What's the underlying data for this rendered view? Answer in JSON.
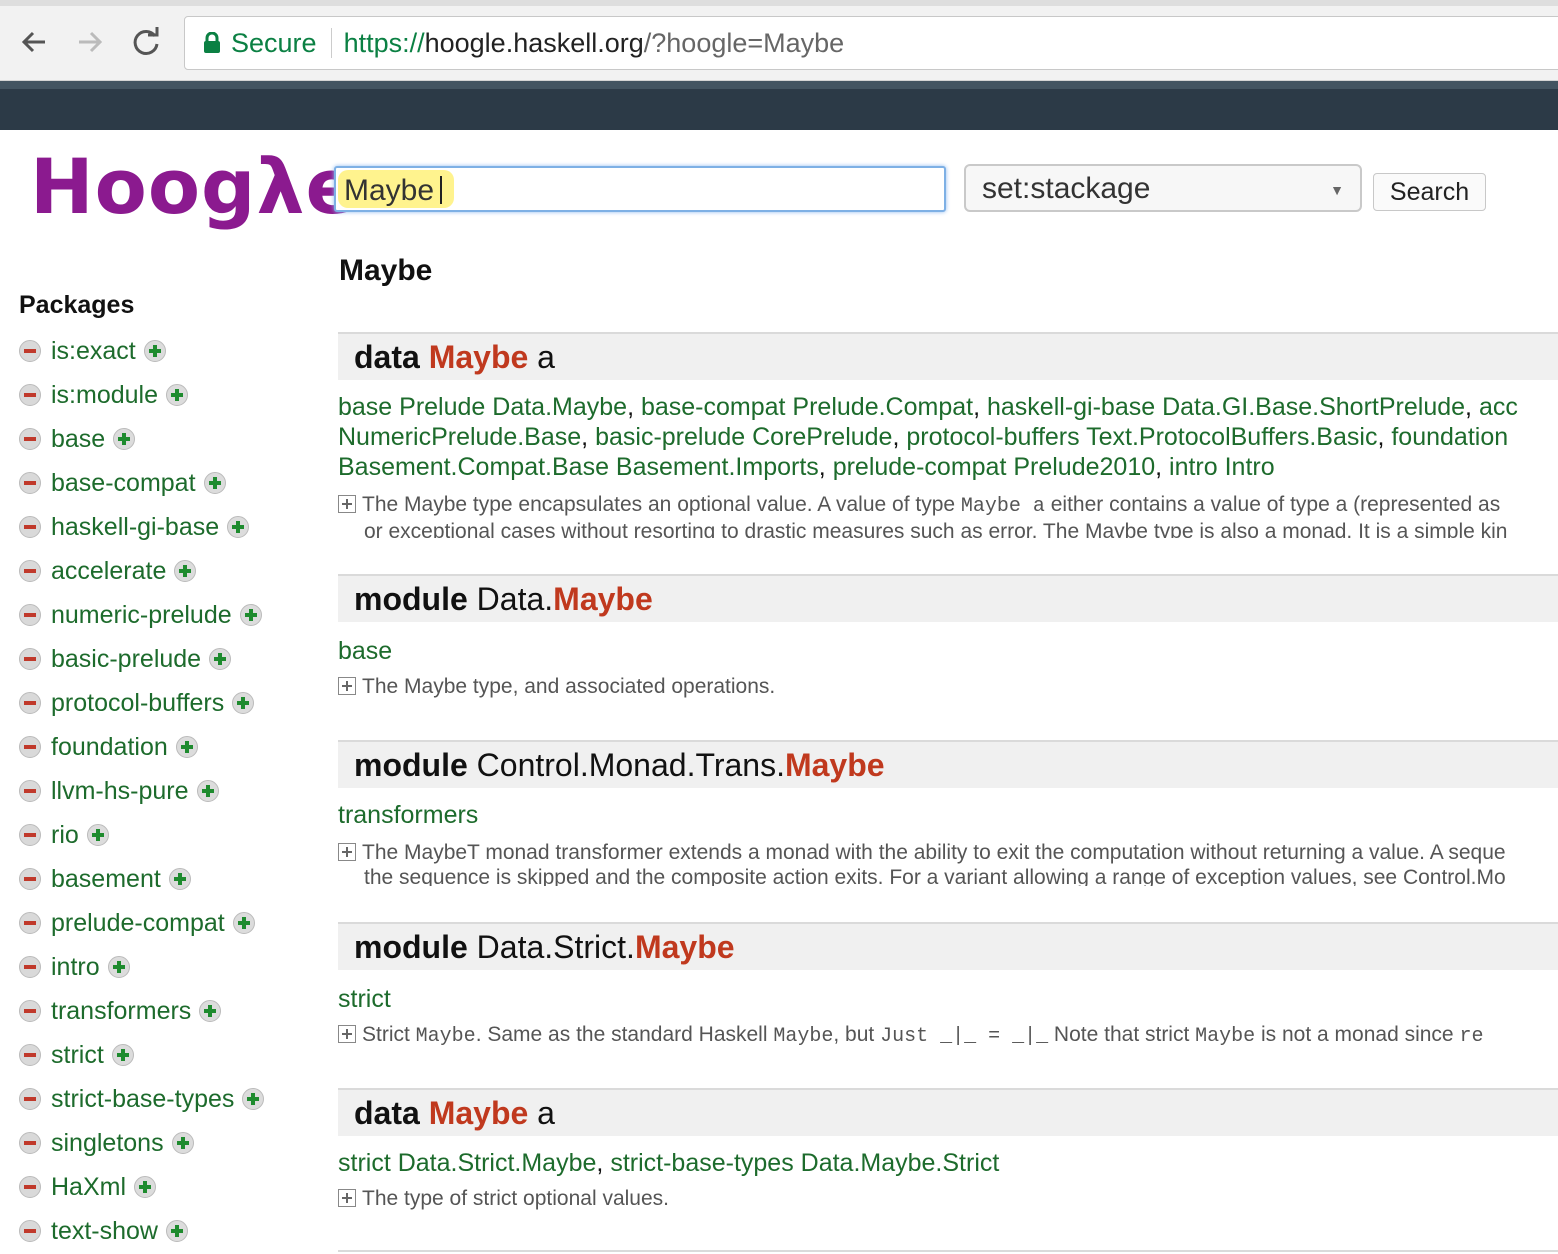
{
  "browser": {
    "secure_label": "Secure",
    "url_scheme": "https://",
    "url_host": "hoogle.haskell.org",
    "url_path": "/?hoogle=Maybe"
  },
  "header": {
    "logo_text": "Hoogλe",
    "search_value": "Maybe",
    "scope_value": "set:stackage",
    "search_button": "Search"
  },
  "sidebar": {
    "title": "Packages",
    "items": [
      {
        "label": "is:exact"
      },
      {
        "label": "is:module"
      },
      {
        "label": "base"
      },
      {
        "label": "base-compat"
      },
      {
        "label": "haskell-gi-base"
      },
      {
        "label": "accelerate"
      },
      {
        "label": "numeric-prelude"
      },
      {
        "label": "basic-prelude"
      },
      {
        "label": "protocol-buffers"
      },
      {
        "label": "foundation"
      },
      {
        "label": "llvm-hs-pure"
      },
      {
        "label": "rio"
      },
      {
        "label": "basement"
      },
      {
        "label": "prelude-compat"
      },
      {
        "label": "intro"
      },
      {
        "label": "transformers"
      },
      {
        "label": "strict"
      },
      {
        "label": "strict-base-types"
      },
      {
        "label": "singletons"
      },
      {
        "label": "HaXml"
      },
      {
        "label": "text-show"
      }
    ]
  },
  "main": {
    "query_title": "Maybe",
    "results": [
      {
        "keyword": "data",
        "prefix": "",
        "hit": "Maybe",
        "suffix": "a",
        "links_line1": [
          {
            "text": "base Prelude Data.Maybe"
          },
          {
            "text": "base-compat Prelude.Compat"
          },
          {
            "text": "haskell-gi-base Data.GI.Base.ShortPrelude"
          },
          {
            "text": "acc"
          }
        ],
        "links_line2": [
          {
            "text": "NumericPrelude.Base"
          },
          {
            "text": "basic-prelude CorePrelude"
          },
          {
            "text": "protocol-buffers Text.ProtocolBuffers.Basic"
          },
          {
            "text": "foundation"
          }
        ],
        "links_line3": [
          {
            "text": "Basement.Compat.Base Basement.Imports"
          },
          {
            "text": "prelude-compat Prelude2010"
          },
          {
            "text": "intro Intro"
          }
        ],
        "doc_a": "The Maybe type encapsulates an optional value. A value of type ",
        "doc_code1": "Maybe a",
        "doc_b": " either contains a value of type a (represented as",
        "doc_line2": "or exceptional cases without resorting to drastic measures such as error. The Maybe type is also a monad. It is a simple kin"
      },
      {
        "keyword": "module",
        "prefix": "Data.",
        "hit": "Maybe",
        "link": "base",
        "doc": "The Maybe type, and associated operations."
      },
      {
        "keyword": "module",
        "prefix": "Control.Monad.Trans.",
        "hit": "Maybe",
        "link": "transformers",
        "doc": "The MaybeT monad transformer extends a monad with the ability to exit the computation without returning a value. A seque",
        "doc_line2": "the sequence is skipped and the composite action exits. For a variant allowing a range of exception values, see Control.Mo"
      },
      {
        "keyword": "module",
        "prefix": "Data.Strict.",
        "hit": "Maybe",
        "link": "strict",
        "doc_p1": "Strict ",
        "doc_c1": "Maybe",
        "doc_p2": ". Same as the standard Haskell ",
        "doc_c2": "Maybe",
        "doc_p3": ", but ",
        "doc_c3": "Just _|_ = _|_",
        "doc_p4": " Note that strict ",
        "doc_c4": "Maybe",
        "doc_p5": " is not a monad since ",
        "doc_c5": "re"
      },
      {
        "keyword": "data",
        "hit": "Maybe",
        "suffix": "a",
        "links": [
          {
            "text": "strict Data.Strict.Maybe"
          },
          {
            "text": "strict-base-types Data.Maybe.Strict"
          }
        ],
        "doc": "The type of strict optional values."
      }
    ]
  }
}
